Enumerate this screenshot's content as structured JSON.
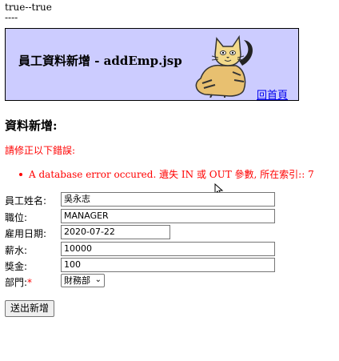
{
  "debug": {
    "line1": "true--true",
    "line2": "----"
  },
  "header": {
    "title": "員工資料新增 - addEmp.jsp",
    "home_link": "回首頁"
  },
  "section_title": "資料新增:",
  "errors": {
    "title": "請修正以下錯誤:",
    "items": [
      "A database error occured. 遺失 IN 或 OUT 參數, 所在索引:: 7"
    ]
  },
  "form": {
    "ename": {
      "label": "員工姓名:",
      "value": "吳永志"
    },
    "job": {
      "label": "職位:",
      "value": "MANAGER"
    },
    "hiredate": {
      "label": "雇用日期:",
      "value": "2020-07-22"
    },
    "sal": {
      "label": "薪水:",
      "value": "10000"
    },
    "comm": {
      "label": "獎金:",
      "value": "100"
    },
    "deptno": {
      "label": "部門:",
      "required_mark": "*",
      "selected": "財務部"
    },
    "submit_label": "送出新增"
  },
  "icons": {
    "mascot": "tomcat-mascot",
    "dropdown": "chevron-down-icon",
    "cursor": "mouse-pointer-icon"
  }
}
